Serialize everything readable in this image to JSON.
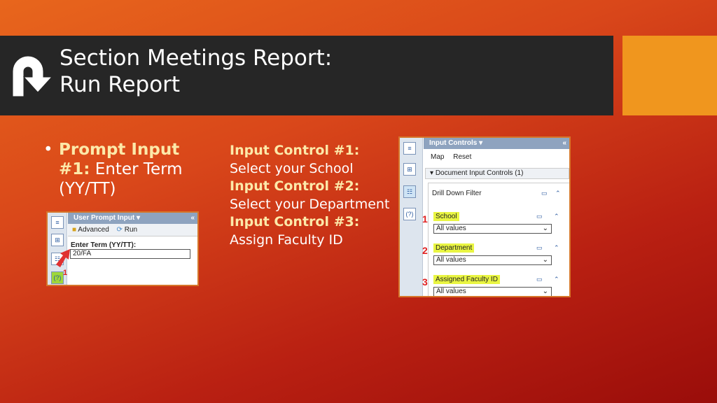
{
  "slide": {
    "title_line1": "Section Meetings Report:",
    "title_line2": "Run Report",
    "logo_icon": "u-turn-arrow-icon",
    "colors": {
      "title_bar": "#262626",
      "accent": "#f0961e",
      "highlight_text": "#fce9a9"
    }
  },
  "bullet": {
    "bold": "Prompt Input #1:",
    "text": " Enter Term (YY/TT)"
  },
  "input_controls_text": [
    {
      "heading": "Input Control #1:",
      "text": "Select your School"
    },
    {
      "heading": "Input Control #2:",
      "text": "Select your Department"
    },
    {
      "heading": "Input Control #3:",
      "text": "Assign Faculty ID"
    }
  ],
  "prompt_panel": {
    "header": "User Prompt Input",
    "advanced": "Advanced",
    "run": "Run",
    "label": "Enter Term  (YY/TT):",
    "value": "20/FA",
    "marker": "1"
  },
  "controls_panel": {
    "header": "Input Controls",
    "map": "Map",
    "reset": "Reset",
    "section": "Document Input Controls (1)",
    "drill": "Drill Down Filter",
    "fields": [
      {
        "label": "School",
        "value": "All values",
        "marker": "1"
      },
      {
        "label": "Department",
        "value": "All values",
        "marker": "2"
      },
      {
        "label": "Assigned Faculty ID",
        "value": "All values",
        "marker": "3"
      }
    ]
  }
}
